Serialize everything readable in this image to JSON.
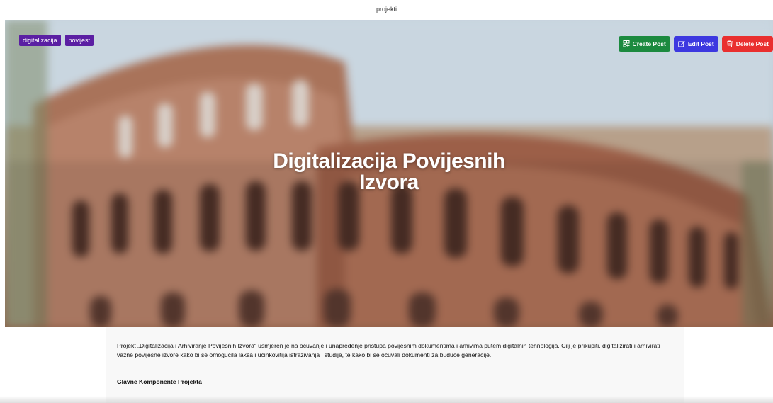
{
  "header": {
    "label": "projekti"
  },
  "hero": {
    "tags": [
      "digitalizacija",
      "povijest"
    ],
    "title_line1": "Digitalizacija Povijesnih",
    "title_line2": "Izvora",
    "actions": {
      "create_label": "Create Post",
      "edit_label": "Edit Post",
      "delete_label": "Delete Post"
    }
  },
  "content": {
    "intro": "Projekt „Digitalizacija i Arhiviranje Povijesnih Izvora“ usmjeren je na očuvanje i unapređenje pristupa povijesnim dokumentima i arhivima putem digitalnih tehnologija. Cilj je prikupiti, digitalizirati i arhivirati važne povijesne izvore kako bi se omogućila lakša i učinkovitija istraživanja i studije, te kako bi se očuvali dokumenti za buduće generacije.",
    "heading": "Glavne Komponente Projekta"
  },
  "colors": {
    "tag": "#5b1fa3",
    "create": "#1b8a3f",
    "edit": "#3c38e0",
    "delete": "#e92f2f"
  },
  "icons": {
    "create": "create-post-icon",
    "edit": "edit-icon",
    "delete": "trash-icon"
  }
}
